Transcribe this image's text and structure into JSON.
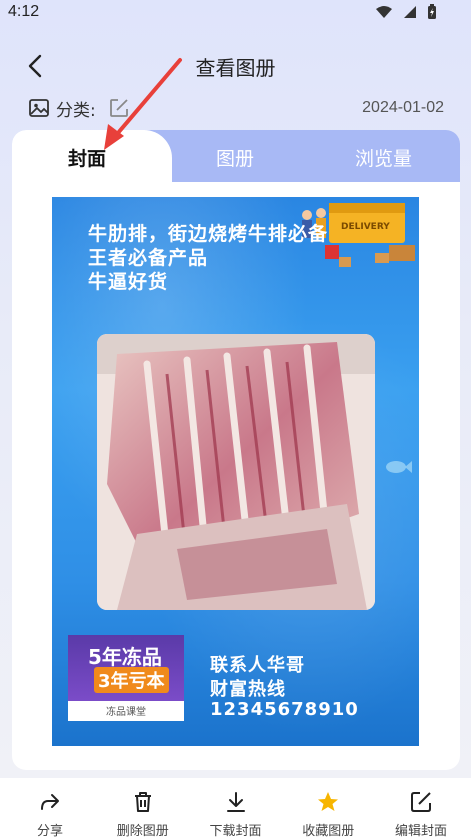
{
  "status_bar": {
    "time": "4:12"
  },
  "nav": {
    "title": "查看图册"
  },
  "meta": {
    "category_label": "分类:",
    "date": "2024-01-02"
  },
  "tabs": [
    {
      "label": "封面",
      "active": true
    },
    {
      "label": "图册",
      "active": false
    },
    {
      "label": "浏览量",
      "active": false
    }
  ],
  "poster": {
    "headline": [
      "牛肋排，街边烧烤牛排必备",
      "王者必备产品",
      "牛逼好货"
    ],
    "truck_text": "DELIVERY",
    "badge": {
      "line1": "5年冻品",
      "line2": "3年亏本",
      "footer": "冻品课堂"
    },
    "contact": [
      "联系人华哥",
      "财富热线",
      "12345678910"
    ]
  },
  "bottom_bar": {
    "items": [
      {
        "label": "分享",
        "icon": "share-icon"
      },
      {
        "label": "删除图册",
        "icon": "trash-icon"
      },
      {
        "label": "下载封面",
        "icon": "download-icon"
      },
      {
        "label": "收藏图册",
        "icon": "star-icon"
      },
      {
        "label": "编辑封面",
        "icon": "edit-icon"
      }
    ]
  },
  "colors": {
    "accent": "#a8b9f5",
    "star": "#f7b500",
    "arrow": "#e8403a"
  }
}
